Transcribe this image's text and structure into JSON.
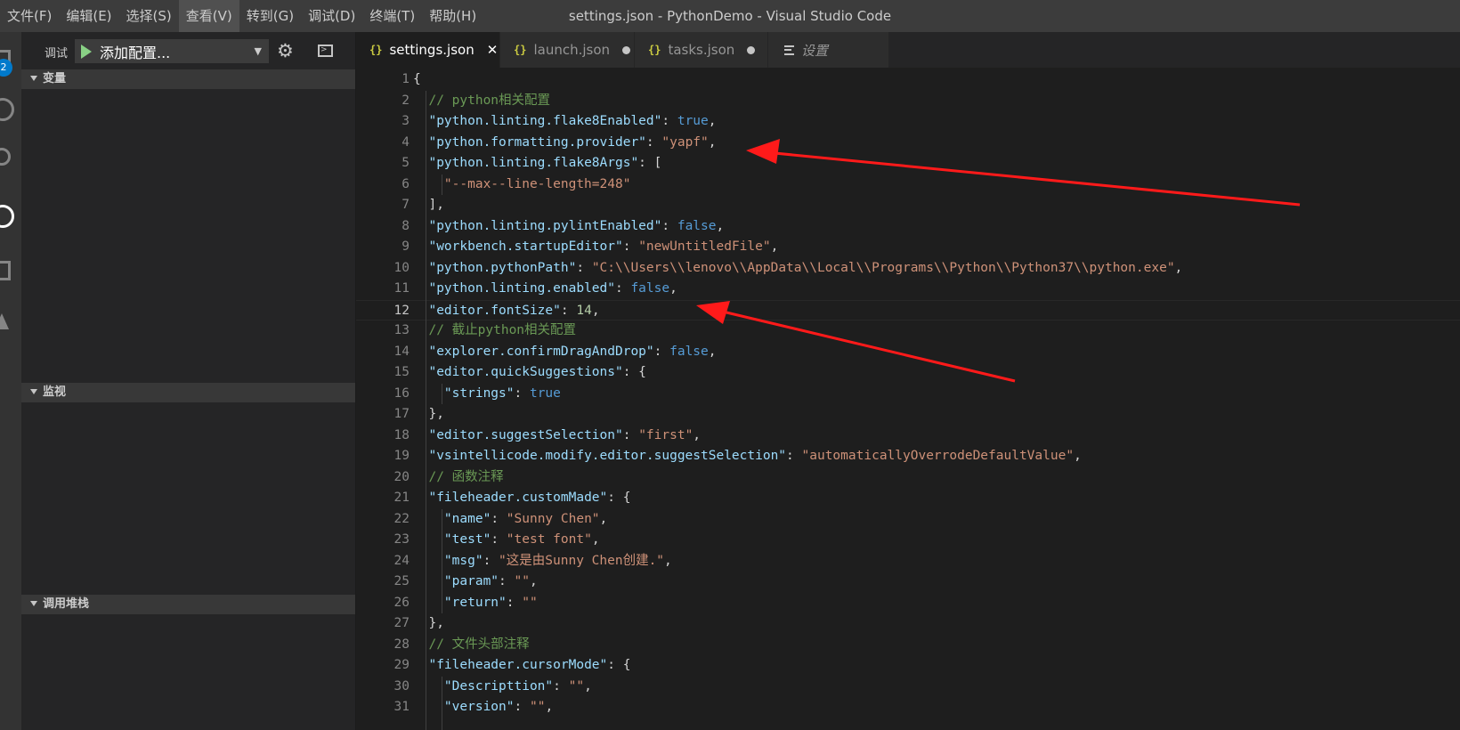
{
  "menu": [
    "文件(F)",
    "编辑(E)",
    "选择(S)",
    "查看(V)",
    "转到(G)",
    "调试(D)",
    "终端(T)",
    "帮助(H)"
  ],
  "window_title": "settings.json - PythonDemo - Visual Studio Code",
  "activity_badge": "2",
  "debug": {
    "label": "调试",
    "config": "添加配置..."
  },
  "sections": {
    "variables": "变量",
    "watch": "监视",
    "callstack": "调用堆栈"
  },
  "tabs": [
    {
      "icon": "{}",
      "label": "settings.json",
      "state": "close"
    },
    {
      "icon": "{}",
      "label": "launch.json",
      "state": "dirty"
    },
    {
      "icon": "{}",
      "label": "tasks.json",
      "state": "dirty"
    },
    {
      "icon": "settings-lines-icon",
      "label": "设置",
      "state": ""
    }
  ],
  "current_line": 12,
  "code_lines": [
    [
      [
        "p",
        "{"
      ]
    ],
    [
      [
        "p",
        "  "
      ],
      [
        "c",
        "// python相关配置"
      ]
    ],
    [
      [
        "p",
        "  "
      ],
      [
        "k",
        "\"python.linting.flake8Enabled\""
      ],
      [
        "p",
        ": "
      ],
      [
        "b",
        "true"
      ],
      [
        "p",
        ","
      ]
    ],
    [
      [
        "p",
        "  "
      ],
      [
        "k",
        "\"python.formatting.provider\""
      ],
      [
        "p",
        ": "
      ],
      [
        "s",
        "\"yapf\""
      ],
      [
        "p",
        ","
      ]
    ],
    [
      [
        "p",
        "  "
      ],
      [
        "k",
        "\"python.linting.flake8Args\""
      ],
      [
        "p",
        ": ["
      ]
    ],
    [
      [
        "p",
        "    "
      ],
      [
        "s",
        "\"--max--line-length=248\""
      ]
    ],
    [
      [
        "p",
        "  ],"
      ]
    ],
    [
      [
        "p",
        "  "
      ],
      [
        "k",
        "\"python.linting.pylintEnabled\""
      ],
      [
        "p",
        ": "
      ],
      [
        "b",
        "false"
      ],
      [
        "p",
        ","
      ]
    ],
    [
      [
        "p",
        "  "
      ],
      [
        "k",
        "\"workbench.startupEditor\""
      ],
      [
        "p",
        ": "
      ],
      [
        "s",
        "\"newUntitledFile\""
      ],
      [
        "p",
        ","
      ]
    ],
    [
      [
        "p",
        "  "
      ],
      [
        "k",
        "\"python.pythonPath\""
      ],
      [
        "p",
        ": "
      ],
      [
        "s",
        "\"C:\\\\Users\\\\lenovo\\\\AppData\\\\Local\\\\Programs\\\\Python\\\\Python37\\\\python.exe\""
      ],
      [
        "p",
        ","
      ]
    ],
    [
      [
        "p",
        "  "
      ],
      [
        "k",
        "\"python.linting.enabled\""
      ],
      [
        "p",
        ": "
      ],
      [
        "b",
        "false"
      ],
      [
        "p",
        ","
      ]
    ],
    [
      [
        "p",
        "  "
      ],
      [
        "k",
        "\"editor.fontSize\""
      ],
      [
        "p",
        ": "
      ],
      [
        "n",
        "14"
      ],
      [
        "p",
        ","
      ]
    ],
    [
      [
        "p",
        "  "
      ],
      [
        "c",
        "// 截止python相关配置"
      ]
    ],
    [
      [
        "p",
        "  "
      ],
      [
        "k",
        "\"explorer.confirmDragAndDrop\""
      ],
      [
        "p",
        ": "
      ],
      [
        "b",
        "false"
      ],
      [
        "p",
        ","
      ]
    ],
    [
      [
        "p",
        "  "
      ],
      [
        "k",
        "\"editor.quickSuggestions\""
      ],
      [
        "p",
        ": {"
      ]
    ],
    [
      [
        "p",
        "    "
      ],
      [
        "k",
        "\"strings\""
      ],
      [
        "p",
        ": "
      ],
      [
        "b",
        "true"
      ]
    ],
    [
      [
        "p",
        "  },"
      ]
    ],
    [
      [
        "p",
        "  "
      ],
      [
        "k",
        "\"editor.suggestSelection\""
      ],
      [
        "p",
        ": "
      ],
      [
        "s",
        "\"first\""
      ],
      [
        "p",
        ","
      ]
    ],
    [
      [
        "p",
        "  "
      ],
      [
        "k",
        "\"vsintellicode.modify.editor.suggestSelection\""
      ],
      [
        "p",
        ": "
      ],
      [
        "s",
        "\"automaticallyOverrodeDefaultValue\""
      ],
      [
        "p",
        ","
      ]
    ],
    [
      [
        "p",
        "  "
      ],
      [
        "c",
        "// 函数注释"
      ]
    ],
    [
      [
        "p",
        "  "
      ],
      [
        "k",
        "\"fileheader.customMade\""
      ],
      [
        "p",
        ": {"
      ]
    ],
    [
      [
        "p",
        "    "
      ],
      [
        "k",
        "\"name\""
      ],
      [
        "p",
        ": "
      ],
      [
        "s",
        "\"Sunny Chen\""
      ],
      [
        "p",
        ","
      ]
    ],
    [
      [
        "p",
        "    "
      ],
      [
        "k",
        "\"test\""
      ],
      [
        "p",
        ": "
      ],
      [
        "s",
        "\"test font\""
      ],
      [
        "p",
        ","
      ]
    ],
    [
      [
        "p",
        "    "
      ],
      [
        "k",
        "\"msg\""
      ],
      [
        "p",
        ": "
      ],
      [
        "s",
        "\"这是由Sunny Chen创建.\""
      ],
      [
        "p",
        ","
      ]
    ],
    [
      [
        "p",
        "    "
      ],
      [
        "k",
        "\"param\""
      ],
      [
        "p",
        ": "
      ],
      [
        "s",
        "\"\""
      ],
      [
        "p",
        ","
      ]
    ],
    [
      [
        "p",
        "    "
      ],
      [
        "k",
        "\"return\""
      ],
      [
        "p",
        ": "
      ],
      [
        "s",
        "\"\""
      ]
    ],
    [
      [
        "p",
        "  },"
      ]
    ],
    [
      [
        "p",
        "  "
      ],
      [
        "c",
        "// 文件头部注释"
      ]
    ],
    [
      [
        "p",
        "  "
      ],
      [
        "k",
        "\"fileheader.cursorMode\""
      ],
      [
        "p",
        ": {"
      ]
    ],
    [
      [
        "p",
        "    "
      ],
      [
        "k",
        "\"Descripttion\""
      ],
      [
        "p",
        ": "
      ],
      [
        "s",
        "\"\""
      ],
      [
        "p",
        ","
      ]
    ],
    [
      [
        "p",
        "    "
      ],
      [
        "k",
        "\"version\""
      ],
      [
        "p",
        ": "
      ],
      [
        "s",
        "\"\""
      ],
      [
        "p",
        ","
      ]
    ]
  ],
  "colors": {
    "annotation_arrow": "#ff1a1a",
    "accent": "#007acc"
  }
}
